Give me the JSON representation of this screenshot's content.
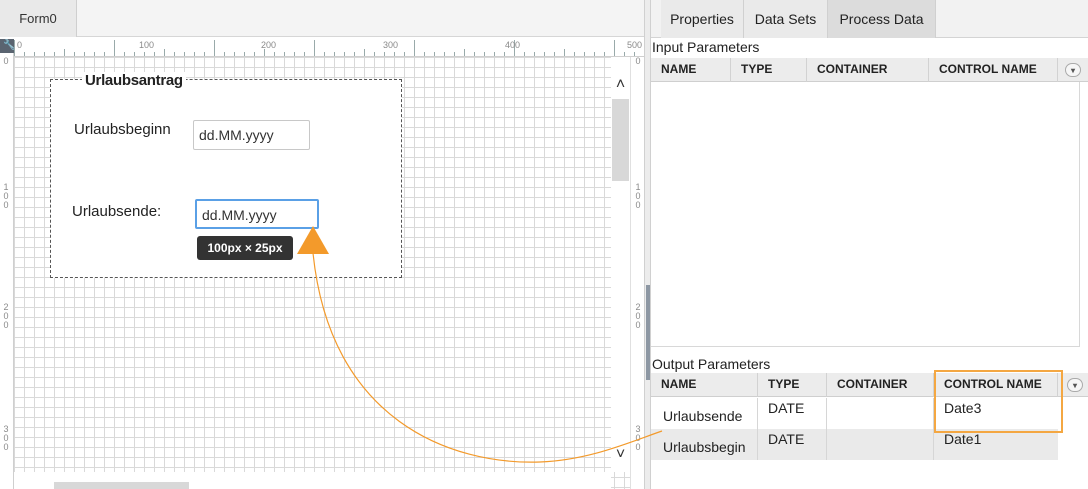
{
  "designer": {
    "form_tab": "Form0",
    "ruler_labels": [
      "0",
      "100",
      "200",
      "300",
      "400",
      "500"
    ],
    "v_ruler_labels": [
      "0",
      "1\n0\n0",
      "2\n0\n0",
      "3\n0\n0"
    ],
    "form_title": "Urlaubsantrag",
    "fields": [
      {
        "label": "Urlaubsbeginn",
        "placeholder": "dd.MM.yyyy"
      },
      {
        "label": "Urlaubsende:",
        "placeholder": "dd.MM.yyyy"
      }
    ],
    "size_tooltip": "100px × 25px",
    "scroll_up_icon": "^",
    "scroll_down_icon": "⌄"
  },
  "panel": {
    "tabs": [
      "Properties",
      "Data Sets",
      "Process Data"
    ],
    "active_tab": "Process Data",
    "input_section": {
      "title": "Input Parameters",
      "columns": [
        "NAME",
        "TYPE",
        "CONTAINER",
        "CONTROL NAME"
      ],
      "rows": []
    },
    "output_section": {
      "title": "Output Parameters",
      "columns": [
        "NAME",
        "TYPE",
        "CONTAINER",
        "CONTROL NAME"
      ],
      "rows": [
        {
          "name": "Urlaubsende",
          "type": "DATE",
          "container": "",
          "control": "Date3"
        },
        {
          "name": "Urlaubsbegin",
          "type": "DATE",
          "container": "",
          "control": "Date1"
        }
      ]
    }
  },
  "colors": {
    "annotation_orange": "#f39a2b",
    "highlight_border": "#f4a742",
    "selection_blue": "#5aa0e6"
  },
  "icons": [
    "wrench-icon",
    "column-menu-icon",
    "scroll-up-icon",
    "scroll-down-icon",
    "arrow-icon"
  ]
}
